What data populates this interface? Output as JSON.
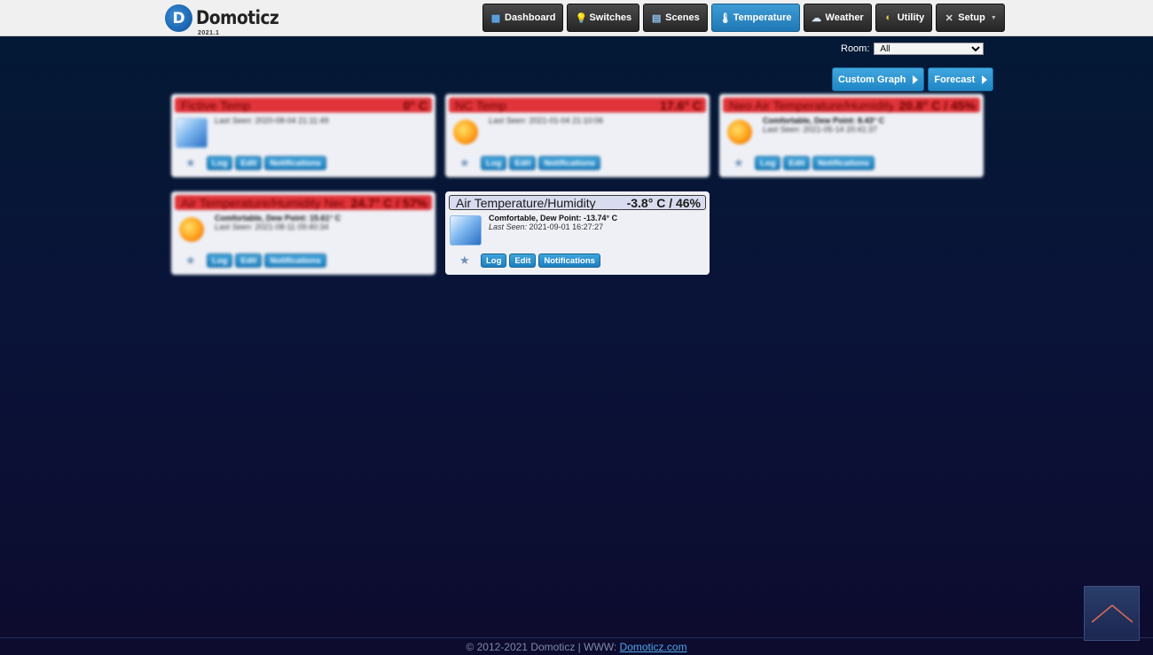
{
  "app": {
    "name": "Domoticz",
    "version": "2021.1"
  },
  "nav": [
    {
      "label": "Dashboard",
      "icon": "dashboard-icon"
    },
    {
      "label": "Switches",
      "icon": "lightbulb-icon"
    },
    {
      "label": "Scenes",
      "icon": "scenes-icon"
    },
    {
      "label": "Temperature",
      "icon": "thermometer-icon",
      "active": true
    },
    {
      "label": "Weather",
      "icon": "cloud-icon"
    },
    {
      "label": "Utility",
      "icon": "utility-icon"
    },
    {
      "label": "Setup",
      "icon": "tools-icon"
    }
  ],
  "room": {
    "label": "Room:",
    "selected": "All"
  },
  "buttons": {
    "custom_graph": "Custom Graph",
    "forecast": "Forecast"
  },
  "cards": [
    {
      "name": "Fictive Temp",
      "value": "0° C",
      "humidity_line": "",
      "last_seen_label": "Last Seen:",
      "last_seen": "2020-08-04 21:11:49",
      "state": "alarm",
      "icon": "ice-icon"
    },
    {
      "name": "NC Temp",
      "value": "17.6° C",
      "humidity_line": "",
      "last_seen_label": "Last Seen:",
      "last_seen": "2021-01-04 21:10:06",
      "state": "alarm",
      "icon": "sun-icon"
    },
    {
      "name": "Neo Air Temperature/Humidity",
      "value": "20.8° C / 45%",
      "humidity_line": "Comfortable, Dew Point: 8.43° C",
      "last_seen_label": "Last Seen:",
      "last_seen": "2021-05-14 20:41:37",
      "state": "alarm",
      "icon": "sun-icon"
    },
    {
      "name": "Air Temperature/Humidity Neo",
      "value": "24.7° C / 57%",
      "humidity_line": "Comfortable, Dew Point: 15.61° C",
      "last_seen_label": "Last Seen:",
      "last_seen": "2021-08-11 09:40:34",
      "state": "alarm",
      "icon": "sun-icon"
    },
    {
      "name": "Air Temperature/Humidity",
      "value": "-3.8° C / 46%",
      "humidity_line": "Comfortable, Dew Point: -13.74° C",
      "last_seen_label": "Last Seen:",
      "last_seen": "2021-09-01 16:27:27",
      "state": "normal",
      "icon": "ice-icon"
    }
  ],
  "card_actions": {
    "log": "Log",
    "edit": "Edit",
    "notifications": "Notifications"
  },
  "footer": {
    "text": "© 2012-2021 Domoticz | WWW: ",
    "link": "Domoticz.com"
  },
  "colors": {
    "accent": "#1f86c6",
    "alarm": "#e0343a",
    "normal_header": "#d9dcef"
  }
}
